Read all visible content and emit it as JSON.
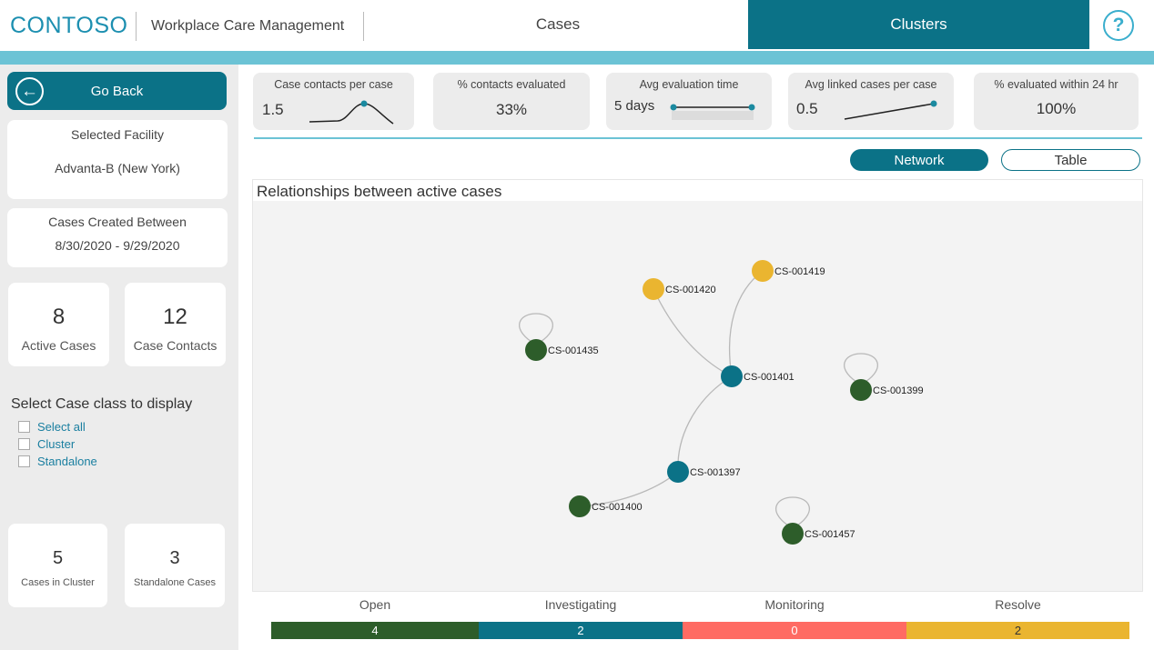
{
  "header": {
    "brand": "CONTOSO",
    "app_title": "Workplace Care Management",
    "tabs": [
      {
        "label": "Cases",
        "active": false
      },
      {
        "label": "Clusters",
        "active": true
      }
    ],
    "help_icon": "?"
  },
  "colors": {
    "primary": "#0b7287",
    "accent": "#6cc3d5",
    "open": "#2d5d2a",
    "investigating": "#0b7287",
    "monitoring": "#ff6b63",
    "resolve": "#eab530"
  },
  "sidebar": {
    "go_back": "Go Back",
    "facility_label": "Selected Facility",
    "facility_value": "Advanta-B (New York)",
    "dates_label": "Cases Created Between",
    "dates_value": "8/30/2020 - 9/29/2020",
    "active_cases": {
      "value": "8",
      "label": "Active Cases"
    },
    "case_contacts": {
      "value": "12",
      "label": "Case Contacts"
    },
    "class_title": "Select Case class to display",
    "class_options": [
      "Select all",
      "Cluster",
      "Standalone"
    ],
    "cases_in_cluster": {
      "value": "5",
      "label": "Cases in Cluster"
    },
    "standalone_cases": {
      "value": "3",
      "label": "Standalone Cases"
    }
  },
  "metrics": [
    {
      "title": "Case contacts per case",
      "value": "1.5"
    },
    {
      "title": "% contacts evaluated",
      "value": "33%"
    },
    {
      "title": "Avg evaluation time",
      "value": "5 days"
    },
    {
      "title": "Avg linked cases per case",
      "value": "0.5"
    },
    {
      "title": "% evaluated within 24 hr",
      "value": "100%"
    }
  ],
  "view_toggle": {
    "network": "Network",
    "table": "Table",
    "active": "Network"
  },
  "graph": {
    "title": "Relationships between active cases",
    "nodes": [
      {
        "id": "CS-001419",
        "status": "resolve"
      },
      {
        "id": "CS-001420",
        "status": "resolve"
      },
      {
        "id": "CS-001435",
        "status": "open",
        "self_loop": true
      },
      {
        "id": "CS-001401",
        "status": "investigating"
      },
      {
        "id": "CS-001399",
        "status": "open",
        "self_loop": true
      },
      {
        "id": "CS-001397",
        "status": "investigating"
      },
      {
        "id": "CS-001400",
        "status": "open"
      },
      {
        "id": "CS-001457",
        "status": "open",
        "self_loop": true
      }
    ],
    "edges": [
      [
        "CS-001419",
        "CS-001401"
      ],
      [
        "CS-001420",
        "CS-001401"
      ],
      [
        "CS-001401",
        "CS-001397"
      ],
      [
        "CS-001397",
        "CS-001400"
      ]
    ]
  },
  "status_legend": [
    {
      "label": "Open",
      "count": "4"
    },
    {
      "label": "Investigating",
      "count": "2"
    },
    {
      "label": "Monitoring",
      "count": "0"
    },
    {
      "label": "Resolve",
      "count": "2"
    }
  ]
}
